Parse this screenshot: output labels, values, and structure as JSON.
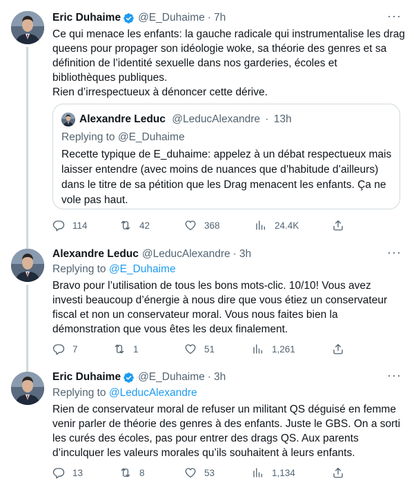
{
  "tweets": [
    {
      "author": "Eric Duhaime",
      "handle": "@E_Duhaime",
      "time": "7h",
      "verified": true,
      "lines": [
        "Ce qui menace les enfants: la gauche radicale qui instrumentalise les drag",
        "queens pour propager son idéologie woke, sa théorie des genres et sa",
        "définition de l’identité sexuelle dans nos garderies, écoles et",
        "bibliothèques publiques.",
        "Rien d’irrespectueux à dénoncer cette dérive."
      ],
      "quote": {
        "author": "Alexandre Leduc",
        "handle": "@LeducAlexandre",
        "time": "13h",
        "replying_label": "Replying to",
        "replying_to": "@E_Duhaime",
        "lines": [
          "Recette typique de E_duhaime: appelez à un débat respectueux mais",
          "laisser entendre (avec moins de nuances que d’habitude d’ailleurs)",
          "dans le titre de sa pétition que les Drag menacent les enfants. Ça ne",
          "vole pas haut."
        ]
      },
      "stats": {
        "replies": "114",
        "retweets": "42",
        "likes": "368",
        "views": "24.4K"
      }
    },
    {
      "author": "Alexandre Leduc",
      "handle": "@LeducAlexandre",
      "time": "3h",
      "verified": false,
      "replying_label": "Replying to",
      "replying_to": "@E_Duhaime",
      "lines": [
        "Bravo pour l’utilisation de tous les bons mots-clic. 10/10! Vous avez",
        "investi beaucoup d’énergie à nous dire que vous étiez un conservateur",
        "fiscal et non un conservateur moral. Vous nous faites bien la",
        "démonstration que vous êtes les deux finalement."
      ],
      "stats": {
        "replies": "7",
        "retweets": "1",
        "likes": "51",
        "views": "1,261"
      }
    },
    {
      "author": "Eric Duhaime",
      "handle": "@E_Duhaime",
      "time": "3h",
      "verified": true,
      "replying_label": "Replying to",
      "replying_to": "@LeducAlexandre",
      "lines": [
        "Rien de conservateur moral de refuser un militant QS déguisé en femme",
        "venir parler de théorie des genres à des enfants. Juste le GBS. On a sorti",
        "les curés des écoles, pas pour entrer des drags QS. Aux parents",
        "d’inculquer les valeurs morales qu’ils souhaitent à leurs enfants."
      ],
      "stats": {
        "replies": "13",
        "retweets": "8",
        "likes": "53",
        "views": "1,134"
      }
    }
  ],
  "separator": "·",
  "more_glyph": "···",
  "colors": {
    "text": "#0f1419",
    "secondary": "#536471",
    "link": "#1d9bf0",
    "verified": "#1d9bf0",
    "border": "#cfd9de"
  },
  "icons": [
    "verified-badge-icon",
    "more-icon",
    "reply-icon",
    "retweet-icon",
    "like-icon",
    "views-icon",
    "share-icon"
  ]
}
